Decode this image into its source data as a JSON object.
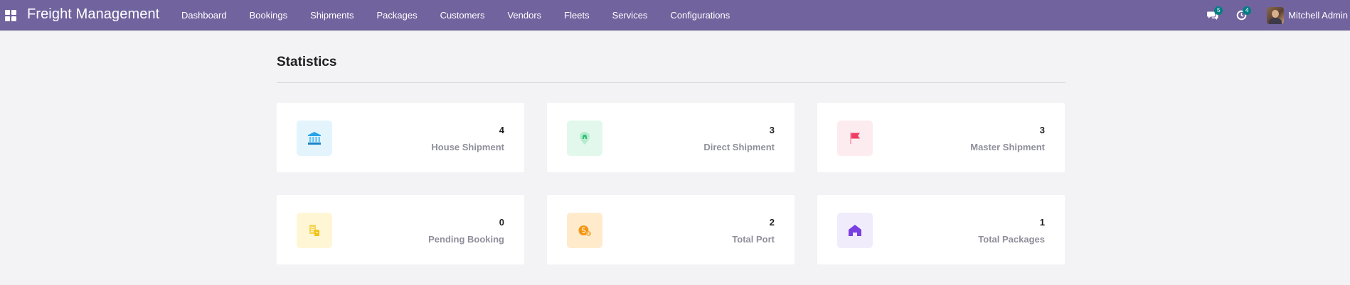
{
  "navbar": {
    "brand": "Freight Management",
    "menu": [
      "Dashboard",
      "Bookings",
      "Shipments",
      "Packages",
      "Customers",
      "Vendors",
      "Fleets",
      "Services",
      "Configurations"
    ],
    "messages_count": "5",
    "activities_count": "4",
    "user_name": "Mitchell Admin",
    "bg_color": "#71639e"
  },
  "page": {
    "title": "Statistics"
  },
  "cards": [
    {
      "value": "4",
      "label": "House Shipment",
      "icon": "bank-icon",
      "icon_bg": "#e3f4fd",
      "icon_color": "#27a4e8"
    },
    {
      "value": "3",
      "label": "Direct Shipment",
      "icon": "map-pin-icon",
      "icon_bg": "#e3f8ec",
      "icon_color": "#30c07a"
    },
    {
      "value": "3",
      "label": "Master Shipment",
      "icon": "flag-icon",
      "icon_bg": "#fdecef",
      "icon_color": "#ee3e63"
    },
    {
      "value": "0",
      "label": "Pending Booking",
      "icon": "documents-icon",
      "icon_bg": "#fff6d5",
      "icon_color": "#f3c316"
    },
    {
      "value": "2",
      "label": "Total Port",
      "icon": "port-coin-icon",
      "icon_bg": "#ffebcc",
      "icon_color": "#f39512"
    },
    {
      "value": "1",
      "label": "Total Packages",
      "icon": "home-icon",
      "icon_bg": "#f1ecfb",
      "icon_color": "#7a3fe0"
    }
  ]
}
